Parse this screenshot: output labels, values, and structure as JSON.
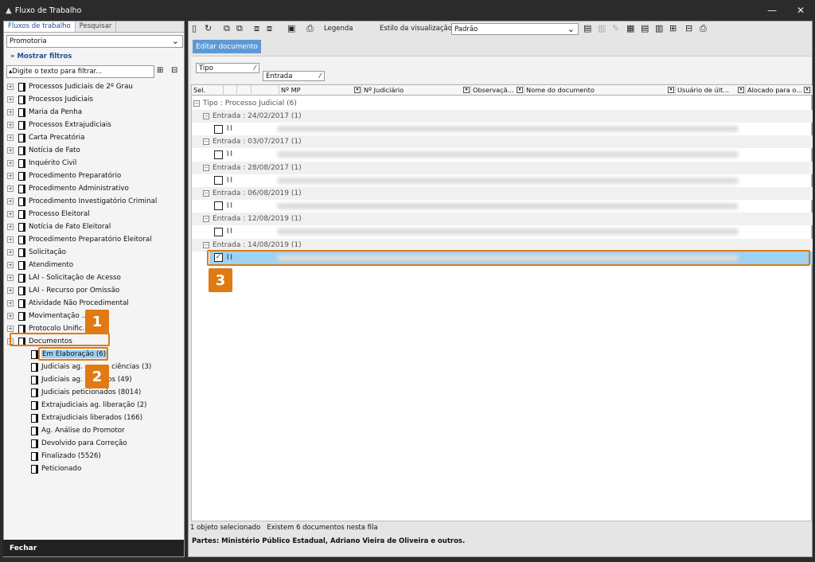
{
  "window": {
    "title": "Fluxo de Trabalho",
    "minimize": "—",
    "close": "✕"
  },
  "left": {
    "tabs": [
      "Fluxos de trabalho",
      "Pesquisar"
    ],
    "select_value": "Promotoria",
    "show_filters": "Mostrar filtros",
    "filter_placeholder": "Digite o texto para filtrar...",
    "close_label": "Fechar",
    "tree": [
      "Processos Judiciais de 2º Grau",
      "Processos Judiciais",
      "Maria da Penha",
      "Processos Extrajudiciais",
      "Carta Precatória",
      "Notícia de Fato",
      "Inquérito Civil",
      "Procedimento Preparatório",
      "Procedimento Administrativo",
      "Procedimento Investigatório Criminal",
      "Processo Eleitoral",
      "Notícia de Fato Eleitoral",
      "Procedimento Preparatório Eleitoral",
      "Solicitação",
      "Atendimento",
      "LAI - Solicitação de Acesso",
      "LAI - Recurso por Omissão",
      "Atividade Não Procedimental",
      "Movimentação ... eira",
      "Protocolo Unific..."
    ],
    "documentos": "Documentos",
    "children": [
      "Em Elaboração (6)",
      "Judiciais ag. ... para ciências (3)",
      "Judiciais ag. ... outros (49)",
      "Judiciais peticionados (8014)",
      "Extrajudiciais ag. liberação (2)",
      "Extrajudiciais liberados (166)",
      "Ag. Análise do Promotor",
      "Devolvido para Correção",
      "Finalizado (5526)",
      "Peticionado"
    ]
  },
  "markers": [
    "1",
    "2",
    "3"
  ],
  "toolbar": {
    "legend": "Legenda",
    "view_style_label": "Estilo da visualização",
    "view_style_value": "Padrão",
    "edit_document": "Editar documento"
  },
  "grouping": {
    "chip1": "Tipo",
    "chip2": "Entrada"
  },
  "columns": [
    "Sel.",
    "",
    "",
    "",
    "Nº MP",
    "Nº Judiciário",
    "Observaçã...",
    "Nome do documento",
    "Usuário de últ...",
    "Alocado para o..."
  ],
  "group_header": "Tipo : Processo Judicial  (6)",
  "entries": [
    "Entrada : 24/02/2017  (1)",
    "Entrada : 03/07/2017  (1)",
    "Entrada : 28/08/2017  (1)",
    "Entrada : 06/08/2019  (1)",
    "Entrada : 12/08/2019  (1)",
    "Entrada : 14/08/2019  (1)"
  ],
  "status": {
    "selected": "1 objeto selecionado",
    "count": "Existem 6 documentos nesta fila",
    "parts": "Partes: Ministério Público Estadual, Adriano Vieira de Oliveira e outros."
  },
  "colors": {
    "accent": "#e07a13",
    "selection": "#9fd1f2",
    "button": "#5d9ad4"
  }
}
